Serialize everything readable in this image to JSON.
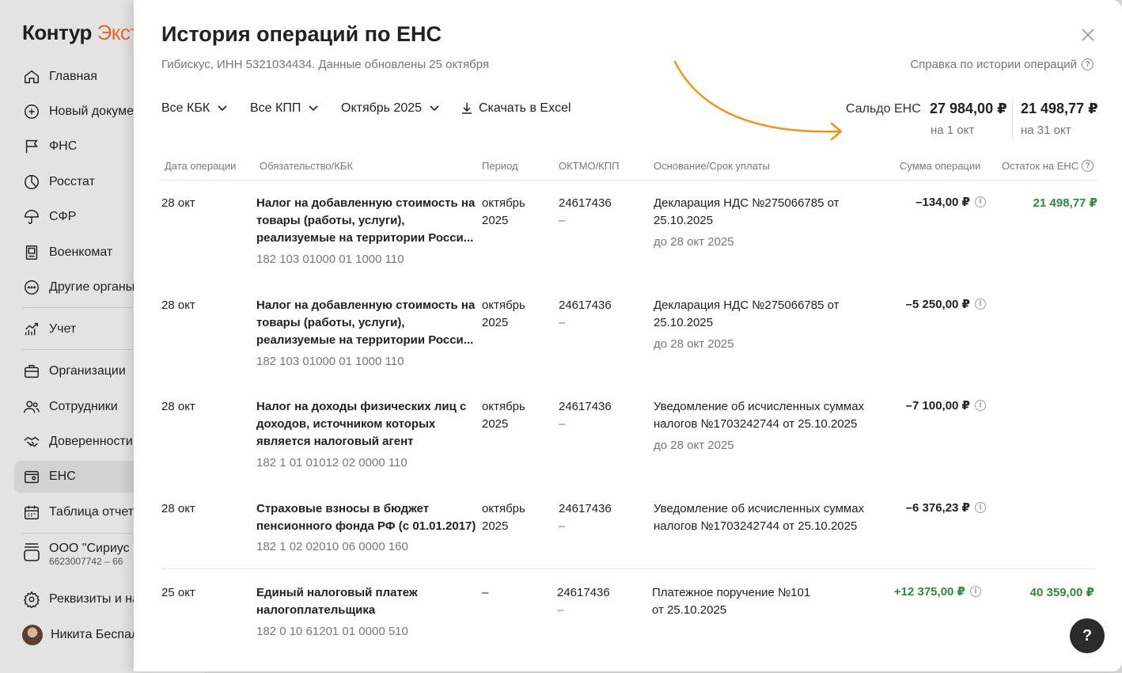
{
  "app": {
    "logo_main": "Контур",
    "logo_accent": "Экст"
  },
  "sidebar": {
    "items": [
      {
        "label": "Главная",
        "icon": "home-icon"
      },
      {
        "label": "Новый документ",
        "icon": "plus-circle-icon"
      },
      {
        "label": "ФНС",
        "icon": "flag-icon"
      },
      {
        "label": "Росстат",
        "icon": "pie-chart-icon"
      },
      {
        "label": "СФР",
        "icon": "umbrella-icon"
      },
      {
        "label": "Военкомат",
        "icon": "id-card-icon"
      },
      {
        "label": "Другие органы",
        "icon": "more-icon"
      },
      {
        "label": "Учет",
        "icon": "trend-chart-icon"
      },
      {
        "label": "Организации",
        "icon": "briefcase-icon"
      },
      {
        "label": "Сотрудники",
        "icon": "people-icon"
      },
      {
        "label": "Доверенности",
        "icon": "handshake-icon"
      },
      {
        "label": "ЕНС",
        "icon": "wallet-icon"
      },
      {
        "label": "Таблица отчетности",
        "icon": "calendar-icon"
      }
    ],
    "org_name": "ООО \"Сириус Е",
    "org_ids": "6623007742 – 66",
    "requisites": "Реквизиты и на",
    "user_name": "Никита Беспал"
  },
  "modal": {
    "title": "История операций по ЕНС",
    "subtitle": "Гибискус, ИНН 5321034434. Данные обновлены 25 октября",
    "help_link": "Справка по истории операций",
    "filters": {
      "kbk": "Все КБК",
      "kpp": "Все КПП",
      "month": "Октябрь 2025",
      "download": "Скачать в Excel"
    },
    "saldo": {
      "label": "Сальдо ЕНС",
      "start_value": "27 984,00 ₽",
      "start_date": "на 1 окт",
      "end_value": "21 498,77 ₽",
      "end_date": "на 31 окт"
    },
    "columns": [
      "Дата операции",
      "Обязательство/КБК",
      "Период",
      "ОКТМО/КПП",
      "Основание/Срок уплаты",
      "Сумма операции",
      "Остаток на ЕНС"
    ],
    "rows": [
      {
        "date": "28 окт",
        "obligation": "Налог на добавленную стоимость на товары (работы, услуги), реализуемые на территории Росси...",
        "kbk": "182 103 01000 01 1000 110",
        "period": "октябрь 2025",
        "oktmo": "24617436",
        "kpp": "–",
        "basis": "Декларация НДС №275066785 от 25.10.2025",
        "due": "до 28 окт 2025",
        "amount": "–134,00 ₽",
        "balance": "21 498,77 ₽"
      },
      {
        "date": "28 окт",
        "obligation": "Налог на добавленную стоимость на товары (работы, услуги), реализуемые на территории Росси...",
        "kbk": "182 103 01000 01 1000 110",
        "period": "октябрь 2025",
        "oktmo": "24617436",
        "kpp": "–",
        "basis": "Декларация НДС №275066785 от 25.10.2025",
        "due": "до 28 окт 2025",
        "amount": "–5 250,00 ₽",
        "balance": ""
      },
      {
        "date": "28 окт",
        "obligation": "Налог на доходы физических лиц с доходов, источником которых является налоговый агент",
        "kbk": "182 1 01 01012 02 0000 110",
        "period": "октябрь 2025",
        "oktmo": "24617436",
        "kpp": "–",
        "basis": "Уведомление об исчисленных суммах налогов №1703242744 от 25.10.2025",
        "due": "до 28 окт 2025",
        "amount": "–7 100,00 ₽",
        "balance": ""
      },
      {
        "date": "28 окт",
        "obligation": "Страховые взносы в бюджет пенсионного фонда РФ (с 01.01.2017)",
        "kbk": "182 1 02 02010 06 0000 160",
        "period": "октябрь 2025",
        "oktmo": "24617436",
        "kpp": "–",
        "basis": "Уведомление об исчисленных суммах налогов №1703242744 от 25.10.2025",
        "due": "",
        "amount": "–6 376,23 ₽",
        "balance": ""
      },
      {
        "date": "25 окт",
        "obligation": "Единый налоговый платеж налогоплательщика",
        "kbk": "182 0 10 61201 01 0000 510",
        "period": "–",
        "oktmo": "24617436",
        "kpp": "–",
        "basis": "Платежное поручение №101 от 25.10.2025",
        "due": "",
        "amount": "+12 375,00 ₽",
        "balance": "40 359,00 ₽"
      }
    ],
    "help_fab": "?"
  },
  "colors": {
    "accent": "#e26a2c",
    "positive": "#2e8b3d",
    "arrow": "#f0921e"
  }
}
